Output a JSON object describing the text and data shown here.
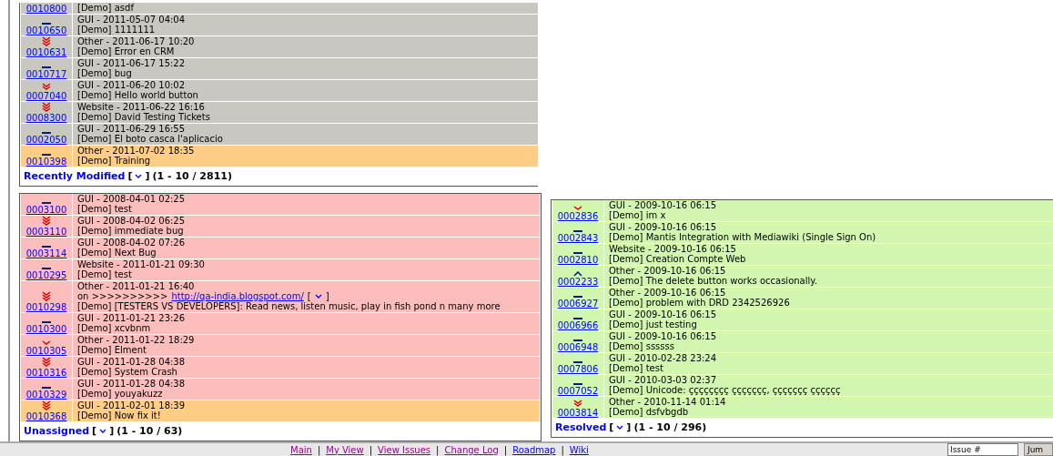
{
  "recently_modified": {
    "title": "Recently Modified",
    "bracket_open": "[",
    "bracket_close": "]",
    "count": "(1 - 10 / 2811)",
    "rows": [
      {
        "id": "0010800",
        "summary": "[Demo] asdf",
        "color": "#c8c8c0"
      },
      {
        "id": "0010650",
        "category_date": "GUI - 2011-05-07 04:04",
        "summary": "[Demo] 1111111",
        "kind": "normal",
        "color": "#c8c8c0"
      },
      {
        "id": "0010631",
        "category_date": "Other - 2011-06-17 10:20",
        "summary": "[Demo] Error en CRM",
        "kind": "immediate",
        "color": "#c8c8c0"
      },
      {
        "id": "0010717",
        "category_date": "GUI - 2011-06-17 15:22",
        "summary": "[Demo] bug",
        "kind": "normal",
        "color": "#c8c8c0"
      },
      {
        "id": "0007040",
        "category_date": "GUI - 2011-06-20 10:02",
        "summary": "[Demo] Hello world button",
        "kind": "urgent",
        "color": "#c8c8c0"
      },
      {
        "id": "0008300",
        "category_date": "Website - 2011-06-22 16:16",
        "summary": "[Demo] David Testing Tickets",
        "kind": "immediate",
        "color": "#c8c8c0"
      },
      {
        "id": "0002050",
        "category_date": "GUI - 2011-06-29 16:55",
        "summary": "[Demo] El boto casca l'aplicacio",
        "kind": "normal",
        "color": "#c8c8c0"
      },
      {
        "id": "0010398",
        "category_date": "Other - 2011-07-02 18:35",
        "summary": "[Demo] Training",
        "kind": "normal",
        "color": "#ffcd85"
      }
    ]
  },
  "unassigned": {
    "title": "Unassigned",
    "bracket_open": "[",
    "bracket_close": "]",
    "count": "(1 - 10 / 63)",
    "rows": [
      {
        "id": "0003100",
        "category_date": "GUI - 2008-04-01 02:25",
        "summary": "[Demo] test",
        "kind": "normal",
        "color": "#fcbdbd"
      },
      {
        "id": "0003110",
        "category_date": "GUI - 2008-04-02 06:25",
        "summary": "[Demo] immediate bug",
        "kind": "immediate",
        "color": "#fcbdbd"
      },
      {
        "id": "0003114",
        "category_date": "GUI - 2008-04-02 07:26",
        "summary": "[Demo] Next Bug",
        "kind": "normal",
        "color": "#fcbdbd"
      },
      {
        "id": "0010295",
        "category_date": "Website - 2011-01-21 09:30",
        "summary": "[Demo] test",
        "kind": "normal",
        "color": "#fcbdbd"
      },
      {
        "id": "0010298",
        "category_date": "Other - 2011-01-21 16:40",
        "summary": "[Demo] [TESTERS VS DEVELOPERS]: Read news, listen music, play in fish pond n many more",
        "link_prefix": "on >>>>>>>>>>",
        "link": "http://qa-india.blogspot.com/",
        "link_open": "[",
        "link_close": "]",
        "kind": "immediate",
        "color": "#fcbdbd"
      },
      {
        "id": "0010300",
        "category_date": "GUI - 2011-01-21 23:26",
        "summary": "[Demo] xcvbnm",
        "kind": "normal",
        "color": "#fcbdbd"
      },
      {
        "id": "0010305",
        "category_date": "Other - 2011-01-22 18:29",
        "summary": "[Demo] Elment",
        "kind": "high",
        "color": "#fcbdbd"
      },
      {
        "id": "0010316",
        "category_date": "GUI - 2011-01-28 04:38",
        "summary": "[Demo] System Crash",
        "kind": "immediate",
        "color": "#fcbdbd"
      },
      {
        "id": "0010329",
        "category_date": "GUI - 2011-01-28 04:38",
        "summary": "[Demo] youyakuzz",
        "kind": "normal",
        "color": "#fcbdbd"
      },
      {
        "id": "0010368",
        "category_date": "GUI - 2011-02-01 18:39",
        "summary": "[Demo] Now fix it!",
        "kind": "immediate",
        "color": "#ffcd85"
      }
    ]
  },
  "resolved": {
    "title": "Resolved",
    "bracket_open": "[",
    "bracket_close": "]",
    "count": "(1 - 10 / 296)",
    "rows": [
      {
        "id": "0002836",
        "category_date": "GUI - 2009-10-16 06:15",
        "summary": "[Demo] im x",
        "kind": "high",
        "color": "#d2f5b0"
      },
      {
        "id": "0002843",
        "category_date": "GUI - 2009-10-16 06:15",
        "summary": "[Demo] Mantis Integration with Mediawiki (Single Sign On)",
        "kind": "normal",
        "color": "#d2f5b0"
      },
      {
        "id": "0002810",
        "category_date": "Website - 2009-10-16 06:15",
        "summary": "[Demo] Creation Compte Web",
        "kind": "normal",
        "color": "#d2f5b0"
      },
      {
        "id": "0002233",
        "category_date": "Other - 2009-10-16 06:15",
        "summary": "[Demo] The delete button works occasionally.",
        "kind": "low",
        "color": "#d2f5b0"
      },
      {
        "id": "0006927",
        "category_date": "Other - 2009-10-16 06:15",
        "summary": "[Demo] problem with DRD 2342526926",
        "kind": "normal",
        "color": "#d2f5b0"
      },
      {
        "id": "0006966",
        "category_date": "GUI - 2009-10-16 06:15",
        "summary": "[Demo] just testing",
        "kind": "normal",
        "color": "#d2f5b0"
      },
      {
        "id": "0006948",
        "category_date": "GUI - 2009-10-16 06:15",
        "summary": "[Demo] ssssss",
        "kind": "normal",
        "color": "#d2f5b0"
      },
      {
        "id": "0007806",
        "category_date": "GUI - 2010-02-28 23:24",
        "summary": "[Demo] test",
        "kind": "normal",
        "color": "#d2f5b0"
      },
      {
        "id": "0007052",
        "category_date": "GUI - 2010-03-03 02:37",
        "summary": "[Demo] Unicode: çççççççç ççççççç, ççççççç çççççç",
        "kind": "normal",
        "color": "#d2f5b0"
      },
      {
        "id": "0003814",
        "category_date": "Other - 2010-11-14 01:14",
        "summary": "[Demo] dsfvbgdb",
        "kind": "urgent",
        "color": "#d2f5b0"
      }
    ]
  },
  "footer_menu": {
    "links": [
      {
        "label": "Main",
        "visited": true
      },
      {
        "label": "My View",
        "visited": true
      },
      {
        "label": "View Issues",
        "visited": true
      },
      {
        "label": "Change Log",
        "visited": true
      },
      {
        "label": "Roadmap",
        "visited": false
      },
      {
        "label": "Wiki",
        "visited": false
      }
    ],
    "separator": "|",
    "issue_field": {
      "value": "Issue #"
    },
    "jump_button": "Jum"
  }
}
